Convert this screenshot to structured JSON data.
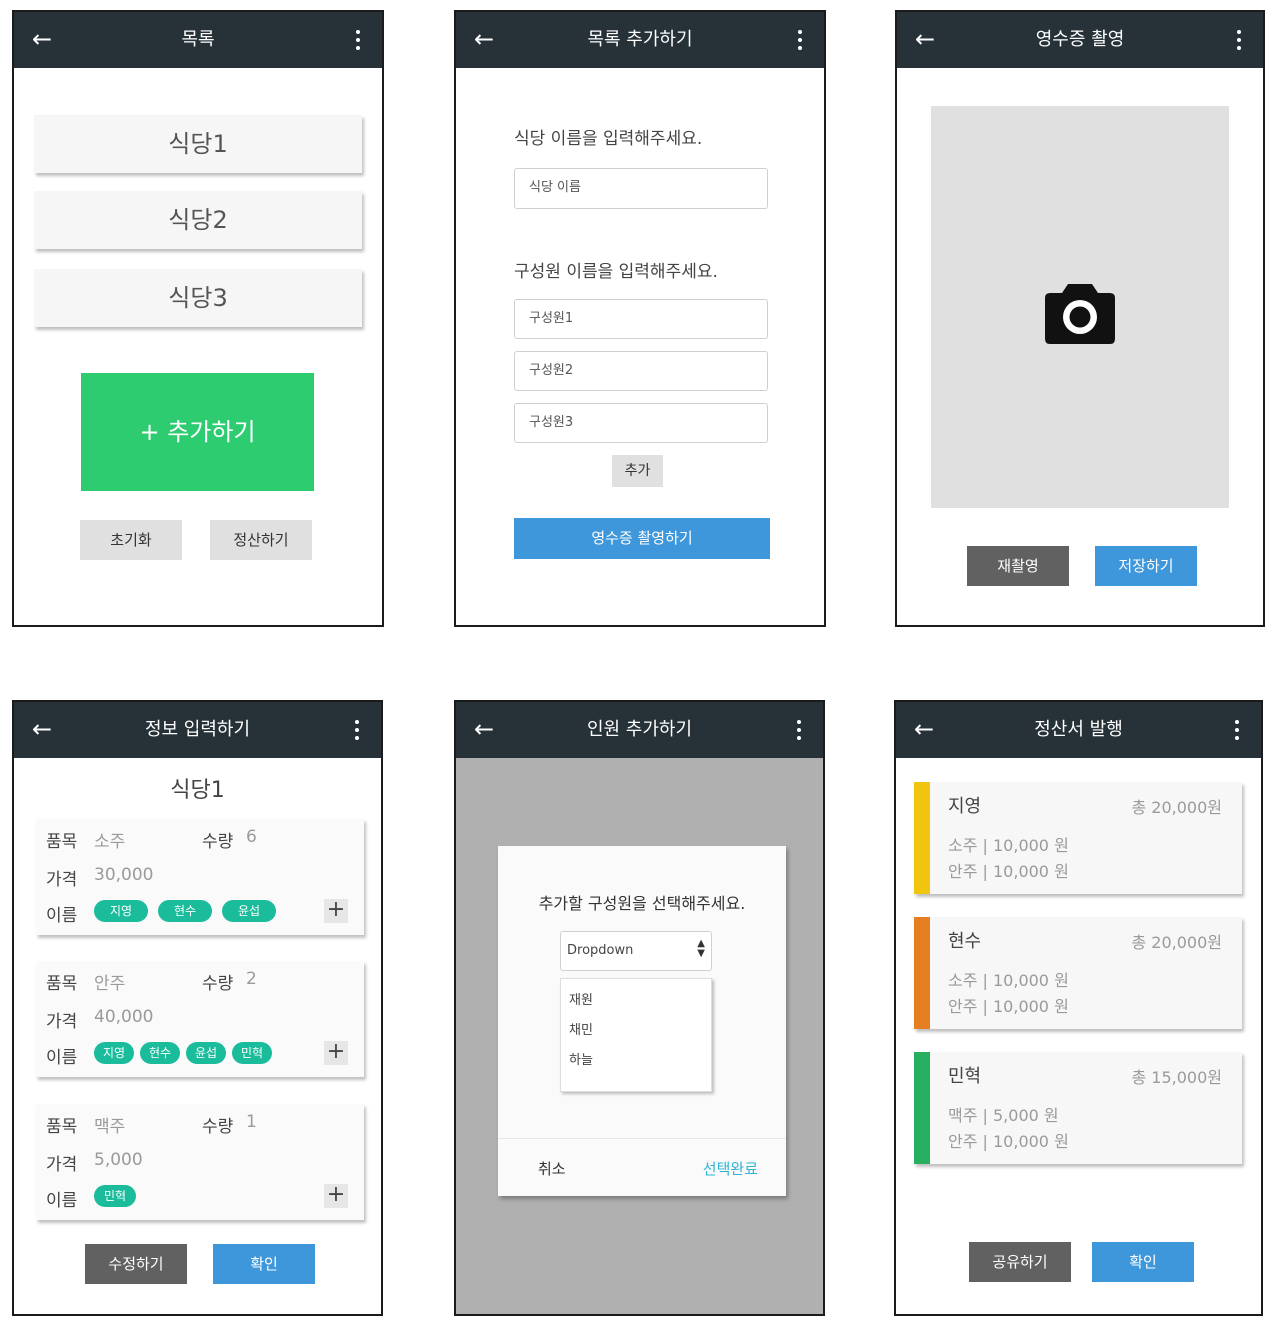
{
  "screen1": {
    "title": "목록",
    "restaurants": [
      "식당1",
      "식당2",
      "식당3"
    ],
    "add_button": "+ 추가하기",
    "reset_button": "초기화",
    "settle_button": "정산하기"
  },
  "screen2": {
    "title": "목록 추가하기",
    "restaurant_prompt": "식당 이름을 입력해주세요.",
    "restaurant_placeholder": "식당 이름",
    "member_prompt": "구성원 이름을 입력해주세요.",
    "member_placeholders": [
      "구성원1",
      "구성원2",
      "구성원3"
    ],
    "add_button": "추가",
    "capture_button": "영수증 촬영하기"
  },
  "screen3": {
    "title": "영수증 촬영",
    "retake_button": "재촬영",
    "save_button": "저장하기"
  },
  "screen4": {
    "title": "정보 입력하기",
    "restaurant_name": "식당1",
    "labels": {
      "item": "품목",
      "qty": "수량",
      "price": "가격",
      "name": "이름"
    },
    "items": [
      {
        "item": "소주",
        "qty": "6",
        "price": "30,000",
        "names": [
          "지영",
          "현수",
          "윤섭"
        ]
      },
      {
        "item": "안주",
        "qty": "2",
        "price": "40,000",
        "names": [
          "지영",
          "현수",
          "윤섭",
          "민혁"
        ]
      },
      {
        "item": "맥주",
        "qty": "1",
        "price": "5,000",
        "names": [
          "민혁"
        ]
      }
    ],
    "edit_button": "수정하기",
    "confirm_button": "확인"
  },
  "screen5": {
    "title": "인원 추가하기",
    "dialog_prompt": "추가할 구성원을 선택해주세요.",
    "dropdown_label": "Dropdown",
    "options": [
      "재원",
      "채민",
      "하늘"
    ],
    "cancel": "취소",
    "done": "선택완료"
  },
  "screen6": {
    "title": "정산서 발행",
    "people": [
      {
        "name": "지영",
        "total": "총 20,000원",
        "color": "#f1c40f",
        "lines": [
          "소주 | 10,000 원",
          "안주 | 10,000 원"
        ]
      },
      {
        "name": "현수",
        "total": "총 20,000원",
        "color": "#e67e22",
        "lines": [
          "소주 | 10,000 원",
          "안주 | 10,000 원"
        ]
      },
      {
        "name": "민혁",
        "total": "총 15,000원",
        "color": "#27ae60",
        "lines": [
          "맥주 | 5,000 원",
          "안주 | 10,000 원"
        ]
      }
    ],
    "share_button": "공유하기",
    "confirm_button": "확인"
  }
}
